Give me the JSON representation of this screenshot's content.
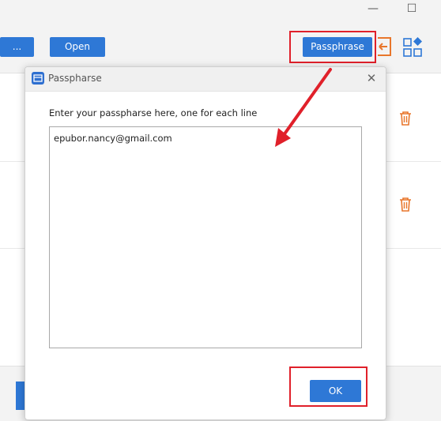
{
  "window": {
    "minimize": "—",
    "maximize": "☐"
  },
  "toolbar": {
    "left_button_label": "...",
    "open_label": "Open",
    "passphrase_label": "Passphrase"
  },
  "dialog": {
    "title": "Passpharse",
    "close": "✕",
    "instruction": "Enter your passpharse here, one for each line",
    "textarea_value": "epubor.nancy@gmail.com",
    "ok_label": "OK"
  },
  "colors": {
    "accent": "#2e78d6",
    "annotation": "#e0202a",
    "trash": "#e8762b",
    "grid_icon": "#2e78d6"
  },
  "icons": [
    "app-icon",
    "trash-icon",
    "grid-icon",
    "arrow-icon",
    "close-icon"
  ]
}
